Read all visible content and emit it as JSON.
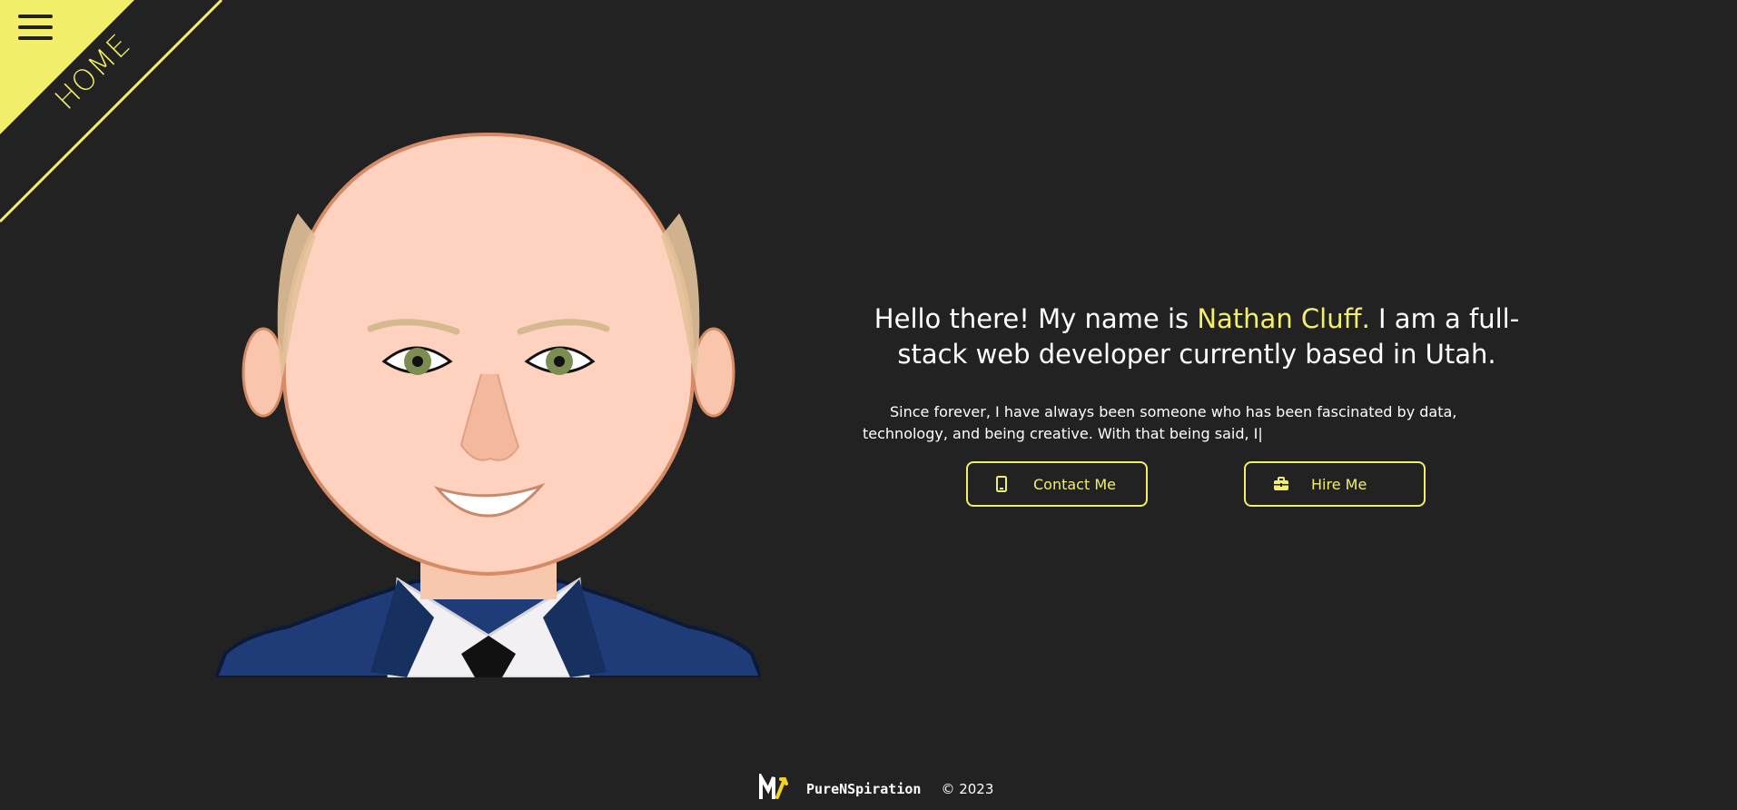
{
  "nav": {
    "section_label": "HOME",
    "menu_icon": "hamburger-menu-icon"
  },
  "hero": {
    "headline_pre": "Hello there! My name is ",
    "headline_name": "Nathan Cluff.",
    "headline_post": " I am a full-stack web developer currently based in Utah.",
    "intro": "Since forever, I have always been someone who has been fascinated by data, technology, and being creative. With that being said, I|"
  },
  "buttons": {
    "contact": {
      "label": "Contact Me",
      "icon": "phone-icon"
    },
    "hire": {
      "label": "Hire Me",
      "icon": "briefcase-icon"
    }
  },
  "footer": {
    "brand": "PureNSpiration",
    "copyright": "© 2023",
    "logo_icon": "brand-logo-icon"
  },
  "colors": {
    "background": "#222222",
    "accent": "#f4ef6a",
    "text": "#ffffff"
  }
}
